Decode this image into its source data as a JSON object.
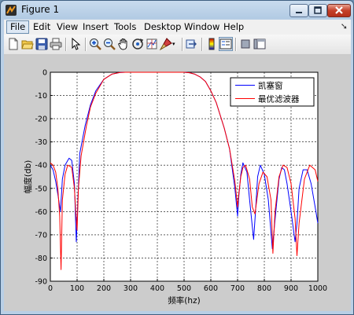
{
  "window": {
    "title": "Figure 1"
  },
  "menu": [
    "File",
    "Edit",
    "View",
    "Insert",
    "Tools",
    "Desktop",
    "Window",
    "Help"
  ],
  "toolbar_icons": [
    "new-figure-icon",
    "open-file-icon",
    "save-icon",
    "print-icon",
    "select-arrow-icon",
    "zoom-in-icon",
    "zoom-out-icon",
    "pan-hand-icon",
    "rotate-3d-icon",
    "data-cursor-icon",
    "brush-icon",
    "link-icon",
    "colorbar-icon",
    "legend-icon",
    "hide-plot-tools-icon",
    "show-plot-tools-icon"
  ],
  "colors": {
    "series1": "#0000ff",
    "series2": "#ff0000",
    "figure_bg": "#cccccc"
  },
  "chart_data": {
    "type": "line",
    "xlabel": "频率(hz)",
    "ylabel": "幅度(db)",
    "xlim": [
      0,
      1000
    ],
    "ylim": [
      -90,
      0
    ],
    "xticks": [
      0,
      100,
      200,
      300,
      400,
      500,
      600,
      700,
      800,
      900,
      1000
    ],
    "yticks": [
      0,
      -10,
      -20,
      -30,
      -40,
      -50,
      -60,
      -70,
      -80,
      -90
    ],
    "grid": true,
    "legend_position": "top-right",
    "series": [
      {
        "name": "凯塞窗",
        "color": "#0000ff",
        "x": [
          0,
          10,
          20,
          30,
          38,
          45,
          55,
          70,
          80,
          90,
          97,
          103,
          110,
          130,
          150,
          170,
          200,
          230,
          260,
          280,
          300,
          320,
          400,
          500,
          520,
          540,
          560,
          580,
          600,
          620,
          650,
          670,
          690,
          700,
          705,
          712,
          720,
          735,
          745,
          760,
          767,
          775,
          785,
          800,
          815,
          830,
          843,
          855,
          865,
          875,
          885,
          900,
          915,
          922,
          930,
          945,
          960,
          975,
          990,
          1000
        ],
        "y": [
          -40,
          -42,
          -47,
          -54,
          -60,
          -46,
          -40,
          -37,
          -38,
          -48,
          -73,
          -55,
          -35,
          -23,
          -14,
          -8,
          -3,
          -0.8,
          -0.1,
          0,
          0,
          0,
          0,
          0,
          -0.2,
          -0.8,
          -2,
          -4,
          -8,
          -13,
          -24,
          -33,
          -50,
          -62,
          -53,
          -44,
          -39,
          -43,
          -55,
          -72,
          -60,
          -45,
          -40,
          -44,
          -55,
          -76,
          -60,
          -46,
          -41,
          -42,
          -48,
          -60,
          -73,
          -65,
          -50,
          -42,
          -42,
          -48,
          -58,
          -65
        ]
      },
      {
        "name": "最优滤波器",
        "color": "#ff0000",
        "x": [
          0,
          10,
          20,
          28,
          35,
          40,
          45,
          55,
          65,
          80,
          90,
          95,
          100,
          105,
          115,
          135,
          150,
          170,
          200,
          230,
          260,
          280,
          300,
          320,
          400,
          500,
          520,
          540,
          560,
          580,
          600,
          620,
          650,
          670,
          690,
          700,
          705,
          712,
          720,
          730,
          745,
          755,
          765,
          780,
          795,
          810,
          825,
          832,
          840,
          855,
          870,
          885,
          900,
          915,
          922,
          930,
          950,
          970,
          990,
          1000
        ],
        "y": [
          -39,
          -40,
          -43,
          -50,
          -62,
          -85,
          -55,
          -44,
          -40,
          -41,
          -50,
          -60,
          -68,
          -50,
          -36,
          -23,
          -15,
          -9,
          -3,
          -0.8,
          -0.1,
          0,
          0,
          0,
          0,
          0,
          -0.2,
          -0.8,
          -2,
          -4,
          -8,
          -13,
          -24,
          -33,
          -47,
          -58,
          -52,
          -45,
          -41,
          -40,
          -46,
          -58,
          -61,
          -48,
          -43,
          -45,
          -55,
          -78,
          -60,
          -45,
          -40,
          -41,
          -48,
          -63,
          -79,
          -65,
          -46,
          -40,
          -42,
          -47
        ]
      }
    ]
  }
}
